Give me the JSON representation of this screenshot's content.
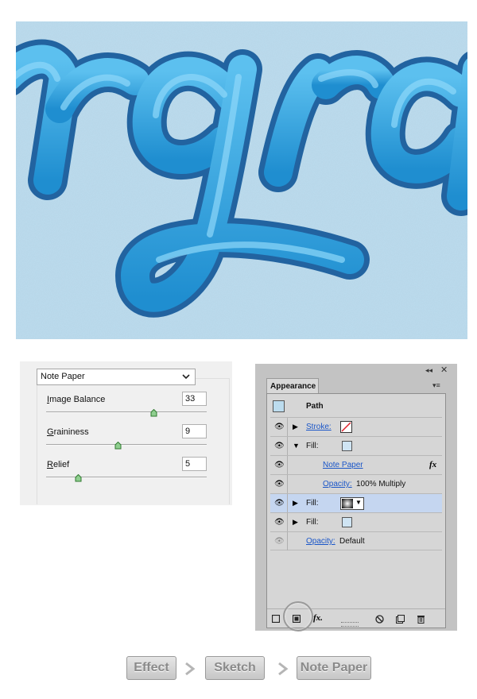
{
  "note_paper": {
    "dropdown_value": "Note Paper",
    "sliders": [
      {
        "label": "Image Balance",
        "value": "33",
        "fraction": 0.67
      },
      {
        "label": "Graininess",
        "value": "9",
        "fraction": 0.45
      },
      {
        "label": "Relief",
        "value": "5",
        "fraction": 0.2
      }
    ]
  },
  "appearance": {
    "tab": "Appearance",
    "header": "Path",
    "stroke_label": "Stroke:",
    "fill_label": "Fill:",
    "note_paper_link": "Note Paper",
    "fx_label": "fx",
    "opacity_label": "Opacity:",
    "opacity_multiply": "100% Multiply",
    "opacity_default": "Default",
    "fx_button": "fx."
  },
  "breadcrumb": [
    "Effect",
    "Sketch",
    "Note Paper"
  ],
  "colors": {
    "artwork_bg": "#bcdcee",
    "letter_fill": "#2f9bd8",
    "letter_stroke": "#2263a0",
    "selected_row": "#c5d6f0"
  }
}
